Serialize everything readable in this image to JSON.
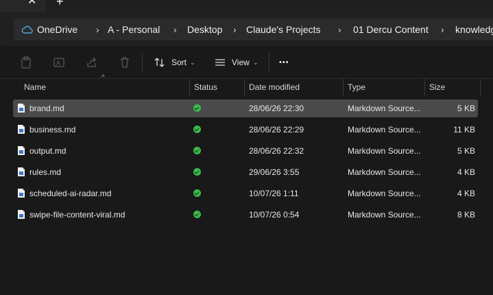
{
  "tabbar": {
    "close_glyph": "✕",
    "new_tab_glyph": "+"
  },
  "breadcrumb": {
    "items": [
      "OneDrive",
      "A - Personal",
      "Desktop",
      "Claude's  Projects",
      "01 Dercu Content",
      "knowledg"
    ],
    "separator": "›"
  },
  "commandbar": {
    "sort_label": "Sort",
    "view_label": "View",
    "more_label": "•••",
    "chevron": "⌄"
  },
  "columns": {
    "name": "Name",
    "status": "Status",
    "date": "Date modified",
    "type": "Type",
    "size": "Size"
  },
  "files": [
    {
      "name": "brand.md",
      "date": "28/06/26 22:30",
      "type": "Markdown Source...",
      "size": "5 KB",
      "selected": true
    },
    {
      "name": "business.md",
      "date": "28/06/26 22:29",
      "type": "Markdown Source...",
      "size": "11 KB"
    },
    {
      "name": "output.md",
      "date": "28/06/26 22:32",
      "type": "Markdown Source...",
      "size": "5 KB"
    },
    {
      "name": "rules.md",
      "date": "29/06/26 3:55",
      "type": "Markdown Source...",
      "size": "4 KB"
    },
    {
      "name": "scheduled-ai-radar.md",
      "date": "10/07/26 1:11",
      "type": "Markdown Source...",
      "size": "4 KB"
    },
    {
      "name": "swipe-file-content-viral.md",
      "date": "10/07/26 0:54",
      "type": "Markdown Source...",
      "size": "8 KB"
    }
  ],
  "colors": {
    "status_ok": "#3cba4d",
    "selection": "#4a4a4a",
    "cloud": "#4fa8e0"
  }
}
